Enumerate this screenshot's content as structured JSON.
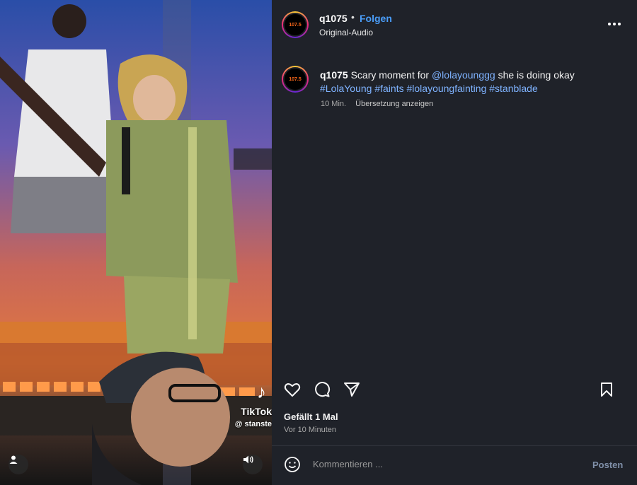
{
  "account": {
    "username": "q1075",
    "follow_label": "Folgen",
    "separator": "•",
    "audio_label": "Original-Audio",
    "avatar_text": "107.5"
  },
  "caption": {
    "username": "q1075",
    "text": "Scary moment for",
    "mention": "@lolayounggg",
    "text_after": "she is doing okay",
    "hashtags": [
      "#LolaYoung",
      "#faints",
      "#lolayoungfainting",
      "#stanblade"
    ],
    "age": "10 Min.",
    "translate_label": "Übersetzung anzeigen"
  },
  "video": {
    "watermark_name": "TikTok",
    "watermark_handle": "@ stanste"
  },
  "engagement": {
    "likes_label": "Gefällt 1 Mal",
    "time_label": "Vor 10 Minuten"
  },
  "comment": {
    "placeholder": "Kommentieren ...",
    "post_label": "Posten"
  },
  "icons": {
    "like": "heart-icon",
    "comment": "comment-icon",
    "share": "share-icon",
    "save": "bookmark-icon",
    "more": "more-icon",
    "emoji": "emoji-icon",
    "user_tag": "user-icon",
    "sound": "speaker-icon"
  },
  "colors": {
    "accent": "#4a9df8",
    "panel_bg": "#1f2229",
    "hashtag": "#7fb3ff"
  }
}
